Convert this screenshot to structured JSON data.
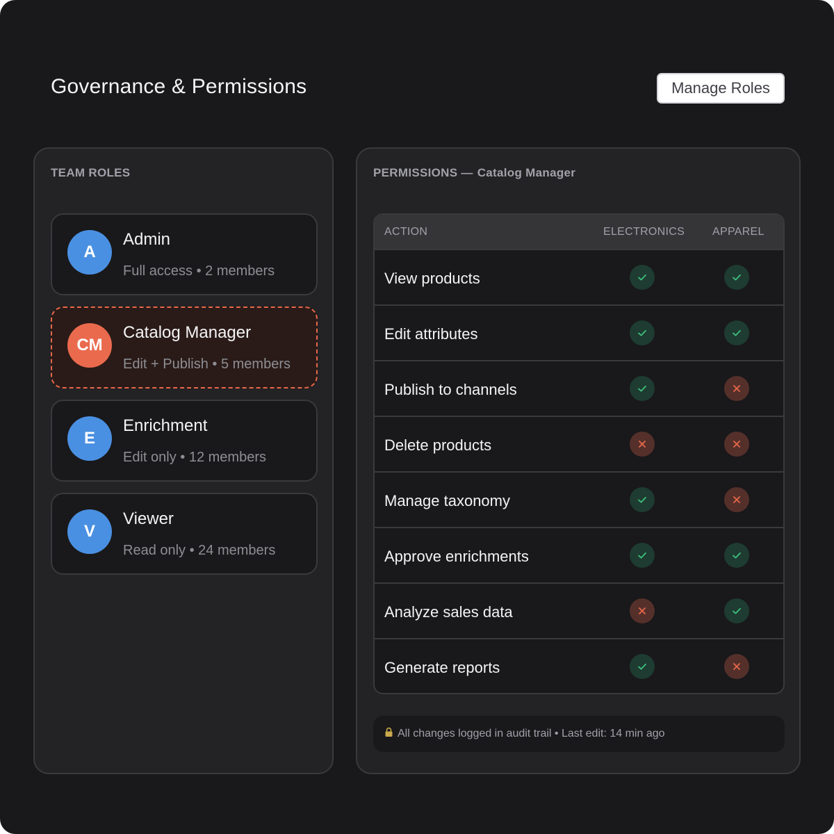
{
  "header": {
    "title": "Governance & Permissions",
    "manage_roles_label": "Manage Roles"
  },
  "roles_panel": {
    "label": "TEAM ROLES",
    "roles": [
      {
        "initials": "A",
        "name": "Admin",
        "description": "Full access • 2 members",
        "avatar_color": "#4a90e2",
        "selected": false
      },
      {
        "initials": "CM",
        "name": "Catalog Manager",
        "description": "Edit + Publish • 5 members",
        "avatar_color": "#ea6a4e",
        "selected": true
      },
      {
        "initials": "E",
        "name": "Enrichment",
        "description": "Edit only • 12 members",
        "avatar_color": "#4a90e2",
        "selected": false
      },
      {
        "initials": "V",
        "name": "Viewer",
        "description": "Read only • 24 members",
        "avatar_color": "#4a90e2",
        "selected": false
      }
    ]
  },
  "permissions_panel": {
    "label_prefix": "PERMISSIONS —",
    "selected_role": "Catalog Manager",
    "columns": {
      "action": "ACTION",
      "electronics": "ELECTRONICS",
      "apparel": "APPAREL"
    },
    "rows": [
      {
        "action": "View products",
        "electronics": true,
        "apparel": true
      },
      {
        "action": "Edit attributes",
        "electronics": true,
        "apparel": true
      },
      {
        "action": "Publish to channels",
        "electronics": true,
        "apparel": false
      },
      {
        "action": "Delete products",
        "electronics": false,
        "apparel": false
      },
      {
        "action": "Manage taxonomy",
        "electronics": true,
        "apparel": false
      },
      {
        "action": "Approve enrichments",
        "electronics": true,
        "apparel": true
      },
      {
        "action": "Analyze sales data",
        "electronics": false,
        "apparel": true
      },
      {
        "action": "Generate reports",
        "electronics": true,
        "apparel": false
      }
    ],
    "audit_note": "All changes logged in audit trail • Last edit: 14 min ago",
    "audit_icon": "lock-icon"
  },
  "colors": {
    "allowed_icon": "#3fbf7f",
    "denied_icon": "#e8684a",
    "accent_selected": "#e8684a"
  }
}
